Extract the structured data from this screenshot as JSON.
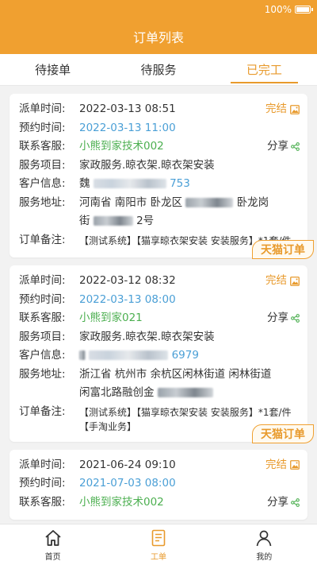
{
  "status_bar": {
    "battery": "100%"
  },
  "header": {
    "title": "订单列表"
  },
  "tabs": [
    {
      "label": "待接单",
      "active": false
    },
    {
      "label": "待服务",
      "active": false
    },
    {
      "label": "已完工",
      "active": true
    }
  ],
  "labels": {
    "dispatch_time": "派单时间:",
    "appointment_time": "预约时间:",
    "support": "联系客服:",
    "service": "服务项目:",
    "customer": "客户信息:",
    "address": "服务地址:",
    "note": "订单备注:"
  },
  "orders": [
    {
      "status": "完结",
      "share": "分享",
      "dispatch_time": "2022-03-13 08:51",
      "appointment_time": "2022-03-13 11:00",
      "support": "小熊到家技术002",
      "service": "家政服务.晾衣架.晾衣架安装",
      "customer_prefix": "魏",
      "customer_suffix": "753",
      "address_line1_a": "河南省 南阳市 卧龙区",
      "address_line1_b": "卧龙岗",
      "address_line2_a": "街",
      "address_line2_b": "2号",
      "note": "【测试系统】【猫享晾衣架安装 安装服务】*1套/件",
      "tag": "天猫订单"
    },
    {
      "status": "完结",
      "share": "分享",
      "dispatch_time": "2022-03-12 08:32",
      "appointment_time": "2022-03-13 08:00",
      "support": "小熊到家021",
      "service": "家政服务.晾衣架.晾衣架安装",
      "customer_prefix": "",
      "customer_suffix": "6979",
      "address_line1_a": "浙江省 杭州市 余杭区闲林街道 闲林街道",
      "address_line1_b": "",
      "address_line2_a": "闲富北路融创金",
      "address_line2_b": "",
      "note": "【测试系统】【猫享晾衣架安装 安装服务】*1套/件【手淘业务】",
      "tag": "天猫订单"
    },
    {
      "status": "完结",
      "share": "分享",
      "dispatch_time": "2021-06-24 09:10",
      "appointment_time": "2021-07-03 08:00",
      "support": "小熊到家技术002"
    }
  ],
  "nav": [
    {
      "label": "首页",
      "icon": "home-icon",
      "active": false
    },
    {
      "label": "工单",
      "icon": "orders-icon",
      "active": true
    },
    {
      "label": "我的",
      "icon": "profile-icon",
      "active": false
    }
  ],
  "colors": {
    "accent": "#f0a030",
    "active_text": "#e89a2c",
    "blue": "#4a9fd6",
    "green": "#4caf50"
  }
}
